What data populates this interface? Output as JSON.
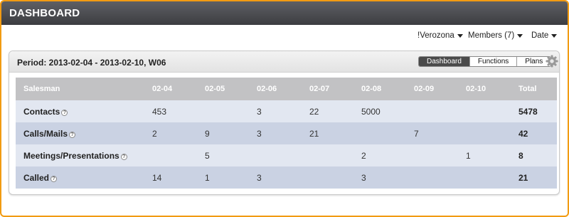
{
  "window": {
    "title": "DASHBOARD"
  },
  "toolbar": {
    "company": "!Verozona",
    "members": "Members (7)",
    "date": "Date"
  },
  "panel": {
    "period": "Period: 2013-02-04 - 2013-02-10, W06",
    "views": [
      "Dashboard",
      "Functions",
      "Plans"
    ],
    "active_view": "Dashboard",
    "settings_icon": "gear-icon"
  },
  "table": {
    "headers": [
      "Salesman",
      "02-04",
      "02-05",
      "02-06",
      "02-07",
      "02-08",
      "02-09",
      "02-10",
      "Total"
    ],
    "rows": [
      {
        "label": "Contacts",
        "cells": [
          "453",
          "",
          "3",
          "22",
          "5000",
          "",
          "",
          "5478"
        ]
      },
      {
        "label": "Calls/Mails",
        "cells": [
          "2",
          "9",
          "3",
          "21",
          "",
          "7",
          "",
          "42"
        ]
      },
      {
        "label": "Meetings/Presentations",
        "cells": [
          "",
          "5",
          "",
          "",
          "2",
          "",
          "1",
          "8"
        ]
      },
      {
        "label": "Called",
        "cells": [
          "14",
          "1",
          "3",
          "",
          "3",
          "",
          "",
          "21"
        ]
      }
    ],
    "help_glyph": "?"
  },
  "colors": {
    "frame_border": "#f29b12",
    "titlebar": "#4a4b50",
    "header_row": "#c2c2c4",
    "row_light": "#e2e7f1",
    "row_dark": "#cad2e3"
  }
}
